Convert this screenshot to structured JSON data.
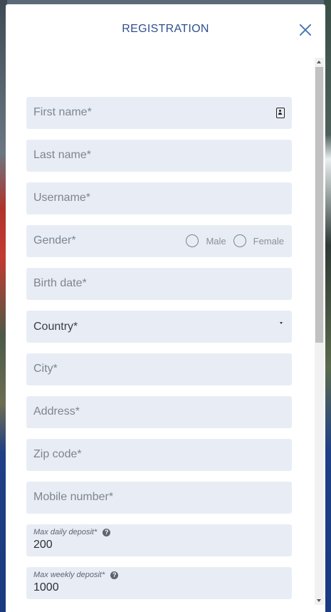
{
  "modal": {
    "title": "REGISTRATION",
    "close_icon": "close-icon"
  },
  "form": {
    "first_name_placeholder": "First name*",
    "last_name_placeholder": "Last name*",
    "username_placeholder": "Username*",
    "gender_label": "Gender*",
    "gender_options": [
      "Male",
      "Female"
    ],
    "birth_date_placeholder": "Birth date*",
    "country_label": "Country*",
    "city_placeholder": "City*",
    "address_placeholder": "Address*",
    "zip_placeholder": "Zip code*",
    "mobile_placeholder": "Mobile number*",
    "max_daily_label": "Max daily deposit*",
    "max_daily_value": "200",
    "max_weekly_label": "Max weekly deposit*",
    "max_weekly_value": "1000"
  },
  "icons": {
    "contact_card": "contact-card-icon",
    "help": "help-circle-icon",
    "caret": "caret-down-icon"
  },
  "colors": {
    "title": "#2f4f8f",
    "close": "#4a78b5",
    "field_bg": "#e8edf5"
  }
}
